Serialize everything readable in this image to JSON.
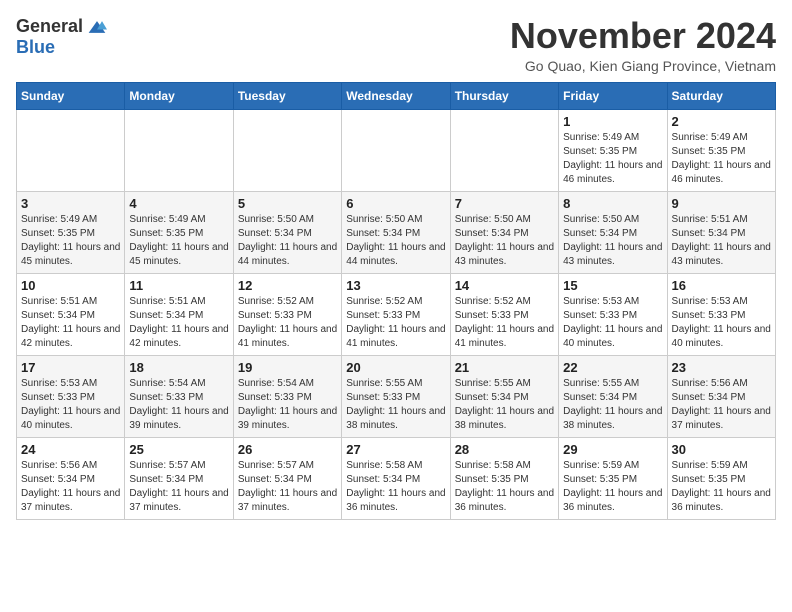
{
  "header": {
    "logo_general": "General",
    "logo_blue": "Blue",
    "month_title": "November 2024",
    "location": "Go Quao, Kien Giang Province, Vietnam"
  },
  "days_of_week": [
    "Sunday",
    "Monday",
    "Tuesday",
    "Wednesday",
    "Thursday",
    "Friday",
    "Saturday"
  ],
  "weeks": [
    [
      {
        "day": "",
        "info": ""
      },
      {
        "day": "",
        "info": ""
      },
      {
        "day": "",
        "info": ""
      },
      {
        "day": "",
        "info": ""
      },
      {
        "day": "",
        "info": ""
      },
      {
        "day": "1",
        "info": "Sunrise: 5:49 AM\nSunset: 5:35 PM\nDaylight: 11 hours\nand 46 minutes."
      },
      {
        "day": "2",
        "info": "Sunrise: 5:49 AM\nSunset: 5:35 PM\nDaylight: 11 hours\nand 46 minutes."
      }
    ],
    [
      {
        "day": "3",
        "info": "Sunrise: 5:49 AM\nSunset: 5:35 PM\nDaylight: 11 hours\nand 45 minutes."
      },
      {
        "day": "4",
        "info": "Sunrise: 5:49 AM\nSunset: 5:35 PM\nDaylight: 11 hours\nand 45 minutes."
      },
      {
        "day": "5",
        "info": "Sunrise: 5:50 AM\nSunset: 5:34 PM\nDaylight: 11 hours\nand 44 minutes."
      },
      {
        "day": "6",
        "info": "Sunrise: 5:50 AM\nSunset: 5:34 PM\nDaylight: 11 hours\nand 44 minutes."
      },
      {
        "day": "7",
        "info": "Sunrise: 5:50 AM\nSunset: 5:34 PM\nDaylight: 11 hours\nand 43 minutes."
      },
      {
        "day": "8",
        "info": "Sunrise: 5:50 AM\nSunset: 5:34 PM\nDaylight: 11 hours\nand 43 minutes."
      },
      {
        "day": "9",
        "info": "Sunrise: 5:51 AM\nSunset: 5:34 PM\nDaylight: 11 hours\nand 43 minutes."
      }
    ],
    [
      {
        "day": "10",
        "info": "Sunrise: 5:51 AM\nSunset: 5:34 PM\nDaylight: 11 hours\nand 42 minutes."
      },
      {
        "day": "11",
        "info": "Sunrise: 5:51 AM\nSunset: 5:34 PM\nDaylight: 11 hours\nand 42 minutes."
      },
      {
        "day": "12",
        "info": "Sunrise: 5:52 AM\nSunset: 5:33 PM\nDaylight: 11 hours\nand 41 minutes."
      },
      {
        "day": "13",
        "info": "Sunrise: 5:52 AM\nSunset: 5:33 PM\nDaylight: 11 hours\nand 41 minutes."
      },
      {
        "day": "14",
        "info": "Sunrise: 5:52 AM\nSunset: 5:33 PM\nDaylight: 11 hours\nand 41 minutes."
      },
      {
        "day": "15",
        "info": "Sunrise: 5:53 AM\nSunset: 5:33 PM\nDaylight: 11 hours\nand 40 minutes."
      },
      {
        "day": "16",
        "info": "Sunrise: 5:53 AM\nSunset: 5:33 PM\nDaylight: 11 hours\nand 40 minutes."
      }
    ],
    [
      {
        "day": "17",
        "info": "Sunrise: 5:53 AM\nSunset: 5:33 PM\nDaylight: 11 hours\nand 40 minutes."
      },
      {
        "day": "18",
        "info": "Sunrise: 5:54 AM\nSunset: 5:33 PM\nDaylight: 11 hours\nand 39 minutes."
      },
      {
        "day": "19",
        "info": "Sunrise: 5:54 AM\nSunset: 5:33 PM\nDaylight: 11 hours\nand 39 minutes."
      },
      {
        "day": "20",
        "info": "Sunrise: 5:55 AM\nSunset: 5:33 PM\nDaylight: 11 hours\nand 38 minutes."
      },
      {
        "day": "21",
        "info": "Sunrise: 5:55 AM\nSunset: 5:34 PM\nDaylight: 11 hours\nand 38 minutes."
      },
      {
        "day": "22",
        "info": "Sunrise: 5:55 AM\nSunset: 5:34 PM\nDaylight: 11 hours\nand 38 minutes."
      },
      {
        "day": "23",
        "info": "Sunrise: 5:56 AM\nSunset: 5:34 PM\nDaylight: 11 hours\nand 37 minutes."
      }
    ],
    [
      {
        "day": "24",
        "info": "Sunrise: 5:56 AM\nSunset: 5:34 PM\nDaylight: 11 hours\nand 37 minutes."
      },
      {
        "day": "25",
        "info": "Sunrise: 5:57 AM\nSunset: 5:34 PM\nDaylight: 11 hours\nand 37 minutes."
      },
      {
        "day": "26",
        "info": "Sunrise: 5:57 AM\nSunset: 5:34 PM\nDaylight: 11 hours\nand 37 minutes."
      },
      {
        "day": "27",
        "info": "Sunrise: 5:58 AM\nSunset: 5:34 PM\nDaylight: 11 hours\nand 36 minutes."
      },
      {
        "day": "28",
        "info": "Sunrise: 5:58 AM\nSunset: 5:35 PM\nDaylight: 11 hours\nand 36 minutes."
      },
      {
        "day": "29",
        "info": "Sunrise: 5:59 AM\nSunset: 5:35 PM\nDaylight: 11 hours\nand 36 minutes."
      },
      {
        "day": "30",
        "info": "Sunrise: 5:59 AM\nSunset: 5:35 PM\nDaylight: 11 hours\nand 36 minutes."
      }
    ]
  ]
}
